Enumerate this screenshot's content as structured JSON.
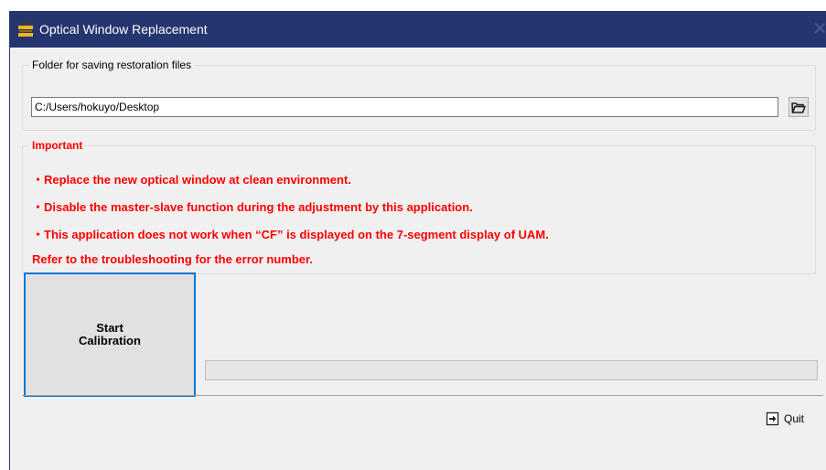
{
  "window": {
    "title": "Optical Window Replacement",
    "title_icon": "app-icon",
    "close_glyph": "✕",
    "titlebar_color": "#243570"
  },
  "folder": {
    "legend": "Folder for saving restoration files",
    "path": "C:/Users/hokuyo/Desktop",
    "browse_icon": "folder-open-icon"
  },
  "important": {
    "legend": "Important",
    "color": "#ff0000",
    "lines": [
      "・Replace the new optical window at clean environment.",
      "・Disable the master-slave function during the adjustment by this application.",
      "・This application does not work when “CF” is displayed on the 7-segment display of UAM.",
      "Refer to the troubleshooting for the error number."
    ]
  },
  "actions": {
    "start_label": "Start\nCalibration",
    "progress_value": 0,
    "quit_label": "Quit",
    "quit_icon": "exit-icon",
    "focus_color": "#0078d7"
  }
}
